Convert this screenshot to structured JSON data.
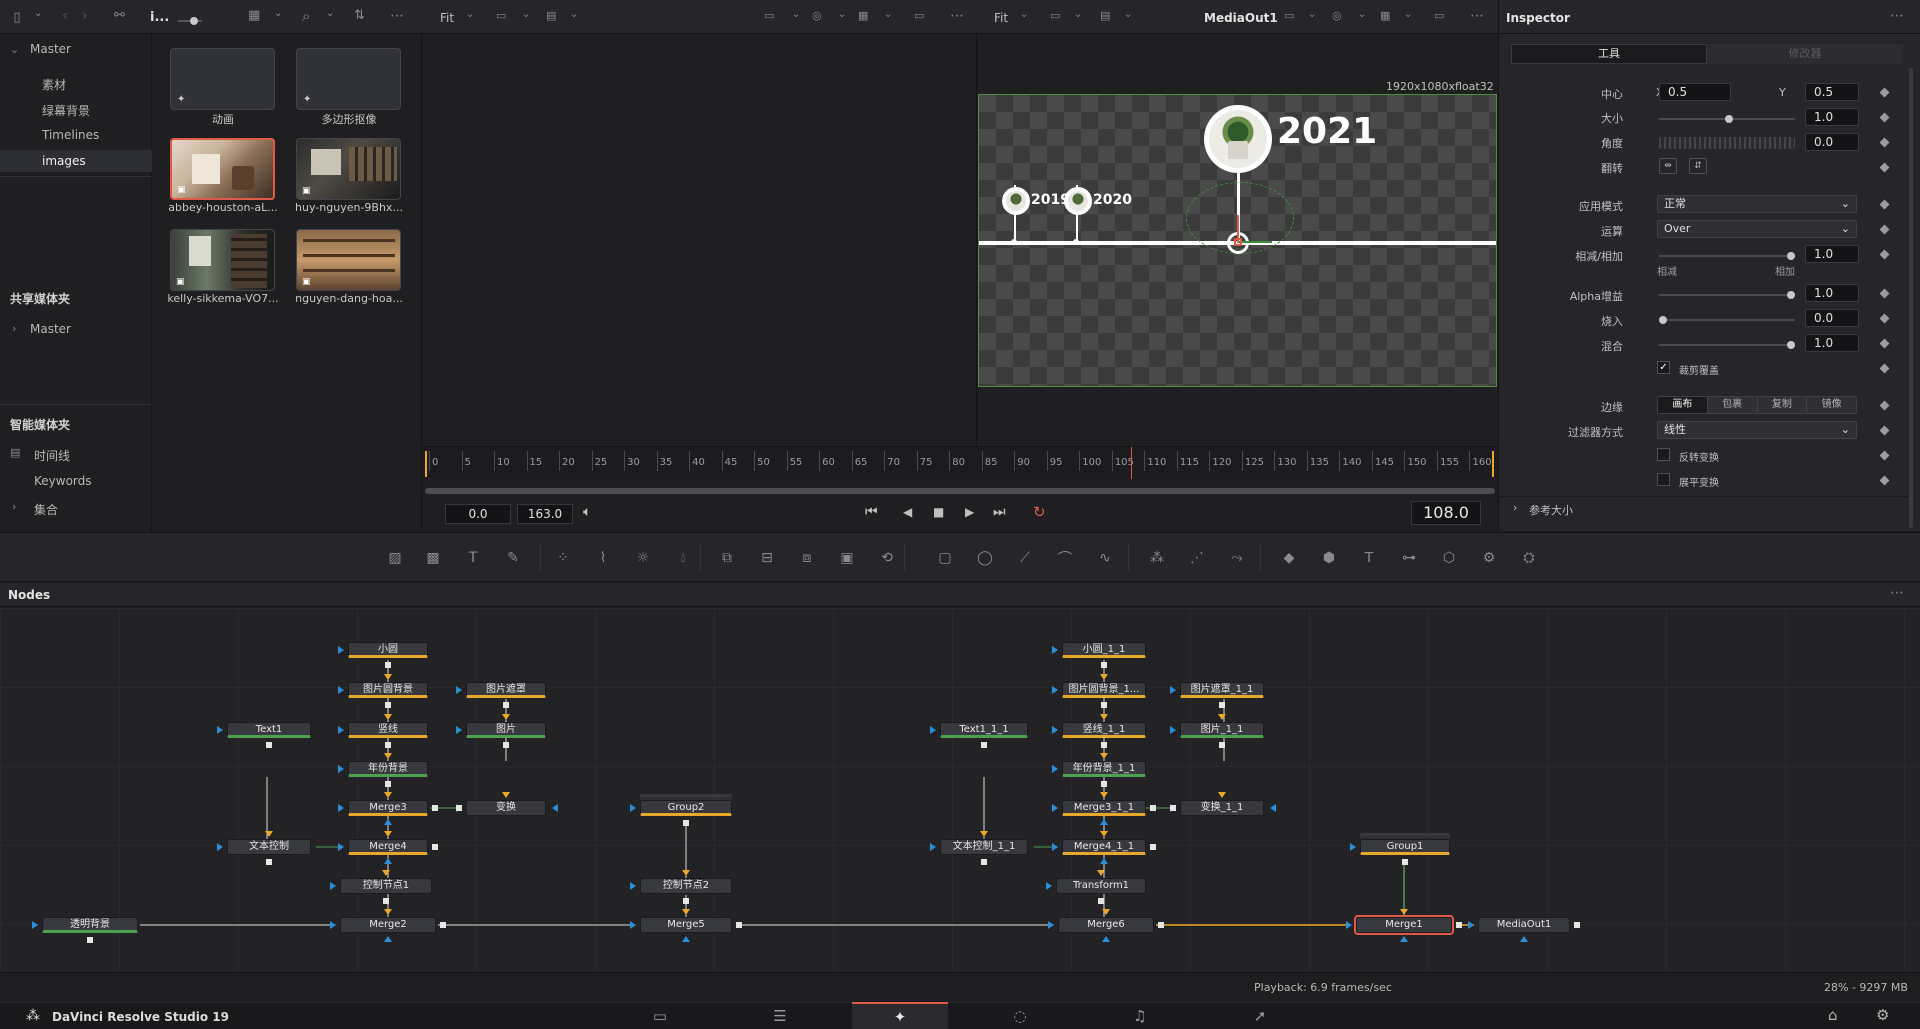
{
  "media_pool": {
    "current_bin": "i...",
    "tree": {
      "master": "Master",
      "items": [
        "素材",
        "绿幕背景",
        "Timelines",
        "images"
      ],
      "selected_index": 3
    },
    "shared_bins": {
      "title": "共享媒体夹",
      "items": [
        "Master"
      ]
    },
    "smart_bins": {
      "title": "智能媒体夹",
      "items": [
        "时间线",
        "Keywords",
        "集合"
      ]
    },
    "clips": [
      {
        "name": "动画",
        "kind": "fusion"
      },
      {
        "name": "多边形抠像",
        "kind": "fusion"
      },
      {
        "name": "abbey-houston-aL...",
        "kind": "image",
        "selected": true
      },
      {
        "name": "huy-nguyen-9Bhx...",
        "kind": "image"
      },
      {
        "name": "kelly-sikkema-VO7...",
        "kind": "image"
      },
      {
        "name": "nguyen-dang-hoa...",
        "kind": "image"
      }
    ]
  },
  "viewer_left": {
    "zoom": "Fit"
  },
  "viewer_right": {
    "zoom": "Fit",
    "title": "MediaOut1",
    "resolution": "1920x1080xfloat32",
    "years": [
      "2019",
      "2020",
      "2021"
    ]
  },
  "timeline": {
    "ticks": [
      "0",
      "5",
      "10",
      "15",
      "20",
      "25",
      "30",
      "35",
      "40",
      "45",
      "50",
      "55",
      "60",
      "65",
      "70",
      "75",
      "80",
      "85",
      "90",
      "95",
      "100",
      "105",
      "110",
      "115",
      "120",
      "125",
      "130",
      "135",
      "140",
      "145",
      "150",
      "155",
      "160"
    ],
    "start": "0.0",
    "end": "163.0",
    "current": "108.0",
    "playhead_value": 108,
    "max": 163
  },
  "inspector": {
    "title": "Inspector",
    "tabs": [
      "工具",
      "修改器"
    ],
    "center_label": "中心",
    "center_x_label": "X",
    "center_x": "0.5",
    "center_y_label": "Y",
    "center_y": "0.5",
    "size_label": "大小",
    "size": "1.0",
    "angle_label": "角度",
    "angle": "0.0",
    "flip_label": "翻转",
    "apply_mode_label": "应用模式",
    "apply_mode": "正常",
    "operator_label": "运算",
    "operator": "Over",
    "subadd_label": "相减/相加",
    "subadd": "1.0",
    "subadd_left": "相减",
    "subadd_right": "相加",
    "alpha_gain_label": "Alpha增益",
    "alpha_gain": "1.0",
    "burn_in_label": "烧入",
    "burn_in": "0.0",
    "blend_label": "混合",
    "blend": "1.0",
    "crop_overlay_label": "裁剪覆盖",
    "edges_label": "边缘",
    "edges_options": [
      "画布",
      "包裹",
      "复制",
      "镜像"
    ],
    "filter_label": "过滤器方式",
    "filter": "线性",
    "invert_label": "反转变换",
    "flatten_label": "展平变换",
    "reference_size": "参考大小"
  },
  "nodes_panel": {
    "title": "Nodes",
    "status": "Playback: 6.9 frames/sec",
    "memory": "28% - 9297 MB",
    "nodes": {
      "n_xiaoyuan": "小圆",
      "n_tupian_yuan_beijing": "图片圆背景",
      "n_shuxian": "竖线",
      "n_nianfen_beijing": "年份背景",
      "n_tupian_zhezhao": "图片遮罩",
      "n_tupian": "图片",
      "n_text1": "Text1",
      "n_merge3": "Merge3",
      "n_bianhuan": "变换",
      "n_wenben_kongzhi": "文本控制",
      "n_merge4": "Merge4",
      "n_kongzhi1": "控制节点1",
      "n_merge2": "Merge2",
      "n_touming": "透明背景",
      "n_group2": "Group2",
      "n_kongzhi2": "控制节点2",
      "n_merge5": "Merge5",
      "n_xiaoyuan_1_1": "小圆_1_1",
      "n_tupian_yuan_beijing_1": "图片圆背景_1...",
      "n_shuxian_1_1": "竖线_1_1",
      "n_nianfen_beijing_1_1": "年份背景_1_1",
      "n_tupian_zhezhao_1_1": "图片遮罩_1_1",
      "n_tupian_1_1": "图片_1_1",
      "n_text1_1_1": "Text1_1_1",
      "n_merge3_1_1": "Merge3_1_1",
      "n_bianhuan_1_1": "变换_1_1",
      "n_wenben_kongzhi_1_1": "文本控制_1_1",
      "n_merge4_1_1": "Merge4_1_1",
      "n_transform1": "Transform1",
      "n_merge6": "Merge6",
      "n_group1": "Group1",
      "n_merge1": "Merge1",
      "n_mediaout1": "MediaOut1"
    }
  },
  "footer": {
    "app_name": "DaVinci Resolve Studio 19"
  },
  "colors": {
    "accent_red": "#e05a4a",
    "link_yellow": "#e8a82a",
    "link_green": "#4fa04f",
    "input_blue": "#2a8fd8"
  }
}
